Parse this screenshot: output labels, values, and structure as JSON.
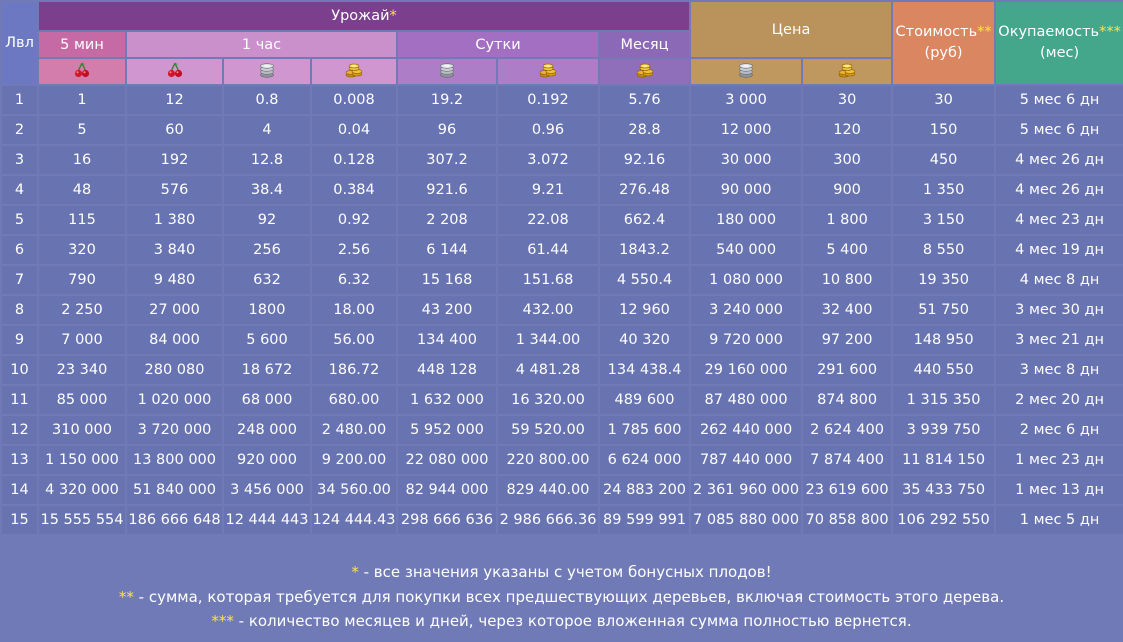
{
  "header": {
    "lvl": "Лвл",
    "harvest": "Урожай",
    "harvest_star": "*",
    "min5": "5 мин",
    "hour1": "1 час",
    "day": "Сутки",
    "month": "Месяц",
    "price": "Цена",
    "cost_line1": "Стоимость",
    "cost_star": "**",
    "cost_line2": "(руб)",
    "payback_line1": "Окупаемость",
    "payback_star": "***",
    "payback_line2": "(мес)"
  },
  "icons": [
    "cherry-icon",
    "cherry-icon",
    "silver-coins-icon",
    "gold-coins-icon",
    "silver-coins-icon",
    "gold-coins-icon",
    "gold-coins-icon",
    "silver-coins-icon",
    "gold-coins-icon"
  ],
  "rows": [
    [
      "1",
      "1",
      "12",
      "0.8",
      "0.008",
      "19.2",
      "0.192",
      "5.76",
      "3 000",
      "30",
      "30",
      "5 мес 6 дн"
    ],
    [
      "2",
      "5",
      "60",
      "4",
      "0.04",
      "96",
      "0.96",
      "28.8",
      "12 000",
      "120",
      "150",
      "5 мес 6 дн"
    ],
    [
      "3",
      "16",
      "192",
      "12.8",
      "0.128",
      "307.2",
      "3.072",
      "92.16",
      "30 000",
      "300",
      "450",
      "4 мес 26 дн"
    ],
    [
      "4",
      "48",
      "576",
      "38.4",
      "0.384",
      "921.6",
      "9.21",
      "276.48",
      "90 000",
      "900",
      "1 350",
      "4 мес 26 дн"
    ],
    [
      "5",
      "115",
      "1 380",
      "92",
      "0.92",
      "2 208",
      "22.08",
      "662.4",
      "180 000",
      "1 800",
      "3 150",
      "4 мес 23 дн"
    ],
    [
      "6",
      "320",
      "3 840",
      "256",
      "2.56",
      "6 144",
      "61.44",
      "1843.2",
      "540 000",
      "5 400",
      "8 550",
      "4 мес 19 дн"
    ],
    [
      "7",
      "790",
      "9 480",
      "632",
      "6.32",
      "15 168",
      "151.68",
      "4 550.4",
      "1 080 000",
      "10 800",
      "19 350",
      "4 мес 8 дн"
    ],
    [
      "8",
      "2 250",
      "27 000",
      "1800",
      "18.00",
      "43 200",
      "432.00",
      "12 960",
      "3 240 000",
      "32 400",
      "51 750",
      "3 мес 30 дн"
    ],
    [
      "9",
      "7 000",
      "84 000",
      "5 600",
      "56.00",
      "134 400",
      "1 344.00",
      "40 320",
      "9 720 000",
      "97 200",
      "148 950",
      "3 мес 21 дн"
    ],
    [
      "10",
      "23 340",
      "280 080",
      "18 672",
      "186.72",
      "448 128",
      "4 481.28",
      "134 438.4",
      "29 160 000",
      "291 600",
      "440 550",
      "3 мес 8 дн"
    ],
    [
      "11",
      "85 000",
      "1 020 000",
      "68 000",
      "680.00",
      "1 632 000",
      "16 320.00",
      "489 600",
      "87 480 000",
      "874 800",
      "1 315 350",
      "2 мес 20 дн"
    ],
    [
      "12",
      "310 000",
      "3 720 000",
      "248 000",
      "2 480.00",
      "5 952 000",
      "59 520.00",
      "1 785 600",
      "262 440 000",
      "2 624 400",
      "3 939 750",
      "2 мес 6 дн"
    ],
    [
      "13",
      "1 150 000",
      "13 800 000",
      "920 000",
      "9 200.00",
      "22 080 000",
      "220 800.00",
      "6 624 000",
      "787 440 000",
      "7 874 400",
      "11 814 150",
      "1 мес 23 дн"
    ],
    [
      "14",
      "4 320 000",
      "51 840 000",
      "3 456 000",
      "34 560.00",
      "82 944 000",
      "829 440.00",
      "24 883 200",
      "2 361 960 000",
      "23 619 600",
      "35 433 750",
      "1 мес 13 дн"
    ],
    [
      "15",
      "15 555 554",
      "186 666 648",
      "12 444 443",
      "124 444.43",
      "298 666 636",
      "2 986 666.36",
      "89 599 991",
      "7 085 880 000",
      "70 858 800",
      "106 292 550",
      "1 мес 5 дн"
    ]
  ],
  "footnotes": [
    {
      "stars": "*",
      "text": " - все значения указаны с учетом бонусных плодов!"
    },
    {
      "stars": "**",
      "text": " - сумма, которая требуется для покупки всех предшествующих деревьев, включая стоимость этого дерева."
    },
    {
      "stars": "***",
      "text": " - количество месяцев и дней, через которое вложенная сумма полностью вернется."
    }
  ],
  "colors": {
    "background": "#6f7ab7",
    "harvest": "#7b3f8d",
    "price": "#b9925c",
    "cost": "#d98661",
    "payback": "#44a68b",
    "star": "#ffe34d"
  }
}
